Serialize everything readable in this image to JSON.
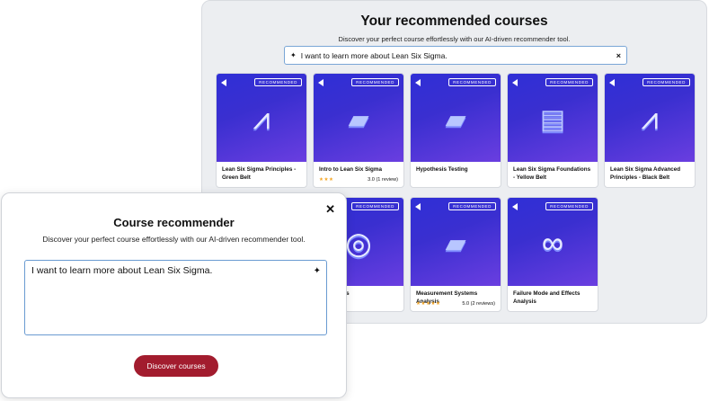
{
  "recommended": {
    "title": "Your recommended courses",
    "subtitle": "Discover your perfect course effortlessly with our AI-driven recommender tool.",
    "search_value": "I want to learn more about Lean Six Sigma.",
    "clear_icon": "close-icon",
    "badge": "RECOMMENDED",
    "courses": [
      {
        "title": "Lean Six Sigma Principles - Green Belt",
        "rating_stars": "",
        "rating_text": ""
      },
      {
        "title": "Intro to Lean Six Sigma",
        "rating_stars": "★★★",
        "rating_text": "3.0 (1 review)"
      },
      {
        "title": "Hypothesis Testing",
        "rating_stars": "",
        "rating_text": ""
      },
      {
        "title": "Lean Six Sigma Foundations - Yellow Belt",
        "rating_stars": "",
        "rating_text": ""
      },
      {
        "title": "Lean Six Sigma Advanced Principles - Black Belt",
        "rating_stars": "",
        "rating_text": ""
      },
      {
        "title": "xperiments",
        "rating_stars": "",
        "rating_text": ""
      },
      {
        "title": "Measurement Systems Analysis",
        "rating_stars": "★★★★★",
        "rating_text": "5.0 (2 reviews)"
      },
      {
        "title": "Failure Mode and Effects Analysis",
        "rating_stars": "",
        "rating_text": ""
      }
    ]
  },
  "modal": {
    "title": "Course recommender",
    "subtitle": "Discover your perfect course effortlessly with our AI-driven recommender tool.",
    "input_value": "I want to learn more about Lean Six Sigma.",
    "button_label": "Discover courses",
    "close_icon": "close-icon"
  },
  "colors": {
    "accent_button": "#a21c2e",
    "card_gradient_start": "#2f2fd6",
    "card_gradient_end": "#6a3ee0",
    "focus_border": "#6a9bd1",
    "star": "#f5a623"
  }
}
